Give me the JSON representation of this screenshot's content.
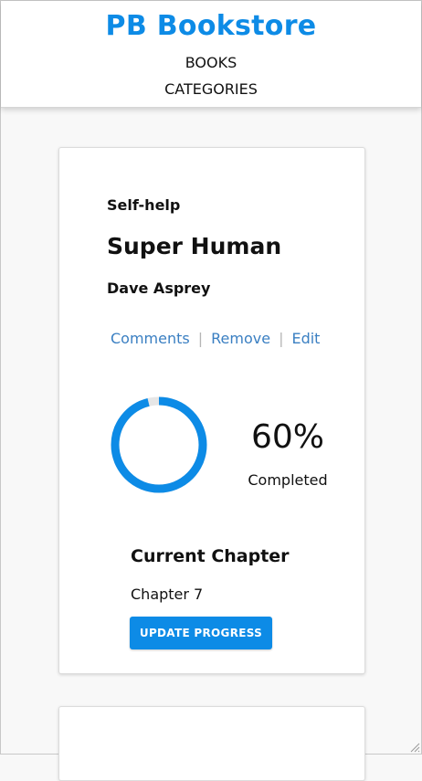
{
  "header": {
    "brand": "PB Bookstore",
    "nav": {
      "books": "BOOKS",
      "categories": "CATEGORIES"
    }
  },
  "book": {
    "category": "Self-help",
    "title": "Super Human",
    "author": "Dave Asprey",
    "actions": {
      "comments": "Comments",
      "remove": "Remove",
      "edit": "Edit"
    },
    "progress": {
      "fraction": 0.96,
      "percent_label": "60%",
      "status": "Completed"
    },
    "current_chapter": {
      "heading": "Current Chapter",
      "value": "Chapter 7"
    },
    "update_button": "UPDATE PROGRESS"
  },
  "theme": {
    "accent": "#0d8be6",
    "link": "#3a7fc2",
    "ring_track": "#e6e6e6"
  }
}
